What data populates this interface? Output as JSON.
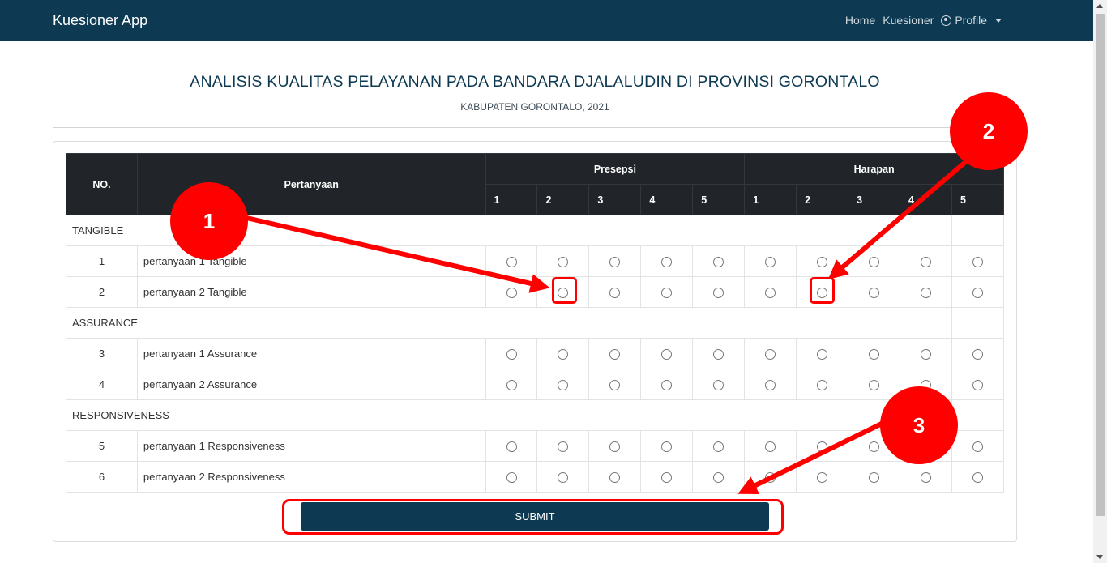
{
  "navbar": {
    "brand": "Kuesioner App",
    "links": [
      "Home",
      "Kuesioner"
    ],
    "profile_label": "Profile"
  },
  "header": {
    "title": "ANALISIS KUALITAS PELAYANAN PADA BANDARA DJALALUDIN DI PROVINSI GORONTALO",
    "subtitle": "KABUPATEN GORONTALO, 2021"
  },
  "table": {
    "col_no": "NO.",
    "col_question": "Pertanyaan",
    "group_perception": "Presepsi",
    "group_expectation": "Harapan",
    "scale": [
      "1",
      "2",
      "3",
      "4",
      "5"
    ],
    "sections": [
      {
        "name": "TANGIBLE",
        "rows": [
          {
            "no": "1",
            "q": "pertanyaan 1 Tangible"
          },
          {
            "no": "2",
            "q": "pertanyaan 2 Tangible"
          }
        ]
      },
      {
        "name": "ASSURANCE",
        "rows": [
          {
            "no": "3",
            "q": "pertanyaan 1 Assurance"
          },
          {
            "no": "4",
            "q": "pertanyaan 2 Assurance"
          }
        ]
      },
      {
        "name": "RESPONSIVENESS",
        "rows": [
          {
            "no": "5",
            "q": "pertanyaan 1 Responsiveness"
          },
          {
            "no": "6",
            "q": "pertanyaan 2 Responsiveness"
          }
        ]
      }
    ]
  },
  "submit_label": "SUBMIT",
  "annotations": {
    "badges": [
      "1",
      "2",
      "3"
    ],
    "color": "#ff0000"
  },
  "colors": {
    "navbar": "#0d3a52",
    "table_header": "#212529",
    "submit": "#0d3a52"
  }
}
